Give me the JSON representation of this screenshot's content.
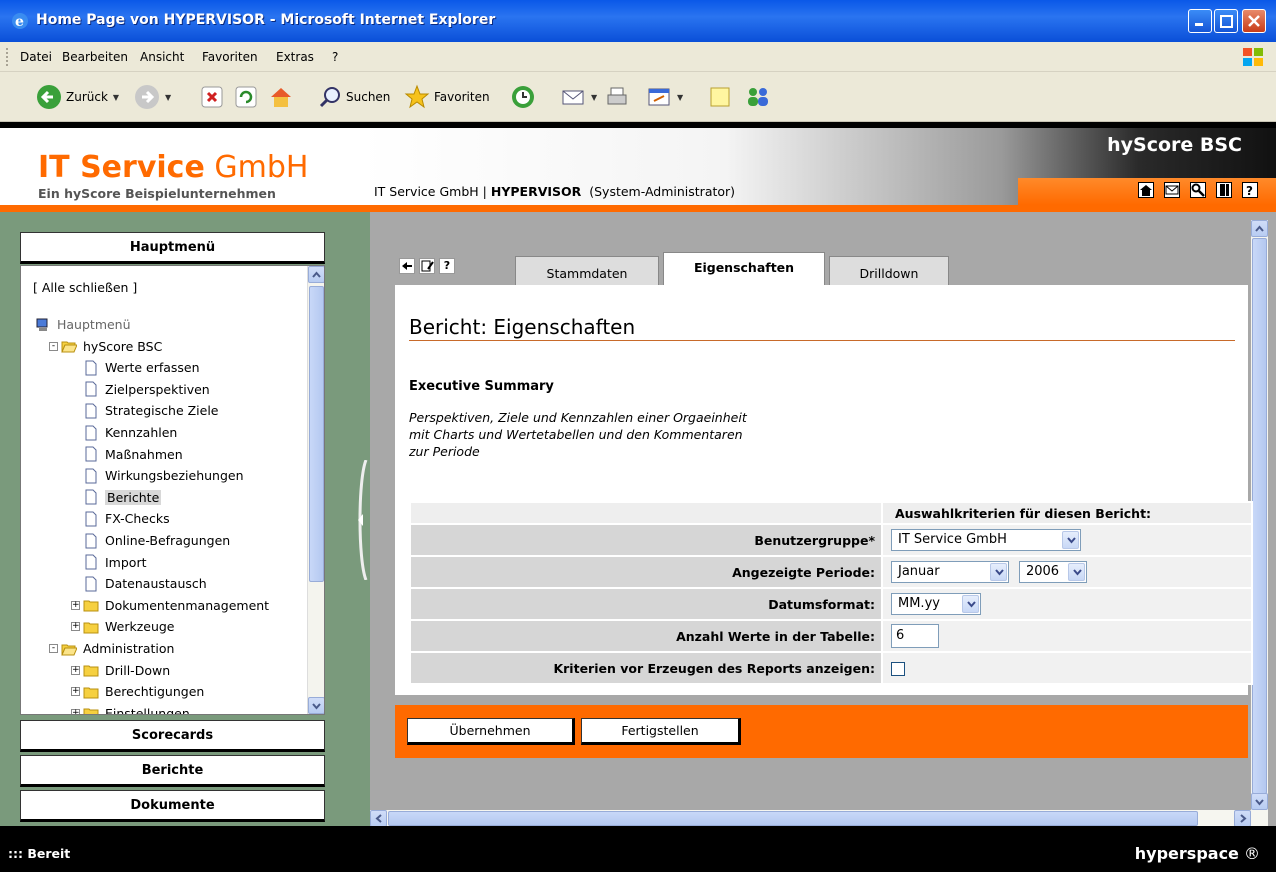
{
  "window": {
    "title": "Home Page von HYPERVISOR - Microsoft Internet Explorer"
  },
  "menubar": {
    "items": [
      "Datei",
      "Bearbeiten",
      "Ansicht",
      "Favoriten",
      "Extras",
      "?"
    ]
  },
  "toolbar": {
    "back_label": "Zurück",
    "search_label": "Suchen",
    "favorites_label": "Favoriten"
  },
  "header": {
    "company_bold": "IT Service",
    "company_rest": "GmbH",
    "tagline": "Ein hyScore Beispielunternehmen",
    "context_company": "IT Service GmbH",
    "context_sep": "|",
    "context_user": "HYPERVISOR",
    "context_role": "(System-Administrator)",
    "brand": "hyScore BSC"
  },
  "sidebar": {
    "main_menu": "Hauptmenü",
    "close_all": "[ Alle schließen ]",
    "tree": [
      {
        "label": "Hauptmenü",
        "level": 0,
        "icon": "computer-icon",
        "muted": true
      },
      {
        "label": "hyScore BSC",
        "level": 1,
        "icon": "folder-open-icon",
        "toggle": "-"
      },
      {
        "label": "Werte erfassen",
        "level": 2,
        "icon": "page-icon"
      },
      {
        "label": "Zielperspektiven",
        "level": 2,
        "icon": "page-icon"
      },
      {
        "label": "Strategische Ziele",
        "level": 2,
        "icon": "page-icon"
      },
      {
        "label": "Kennzahlen",
        "level": 2,
        "icon": "page-icon"
      },
      {
        "label": "Maßnahmen",
        "level": 2,
        "icon": "page-icon"
      },
      {
        "label": "Wirkungsbeziehungen",
        "level": 2,
        "icon": "page-icon"
      },
      {
        "label": "Berichte",
        "level": 2,
        "icon": "page-icon",
        "selected": true
      },
      {
        "label": "FX-Checks",
        "level": 2,
        "icon": "page-icon"
      },
      {
        "label": "Online-Befragungen",
        "level": 2,
        "icon": "page-icon"
      },
      {
        "label": "Import",
        "level": 2,
        "icon": "page-icon"
      },
      {
        "label": "Datenaustausch",
        "level": 2,
        "icon": "page-icon"
      },
      {
        "label": "Dokumentenmanagement",
        "level": 2,
        "icon": "folder-icon",
        "toggle": "+"
      },
      {
        "label": "Werkzeuge",
        "level": 2,
        "icon": "folder-icon",
        "toggle": "+"
      },
      {
        "label": "Administration",
        "level": 1,
        "icon": "folder-open-icon",
        "toggle": "-"
      },
      {
        "label": "Drill-Down",
        "level": 2,
        "icon": "folder-icon",
        "toggle": "+"
      },
      {
        "label": "Berechtigungen",
        "level": 2,
        "icon": "folder-icon",
        "toggle": "+"
      },
      {
        "label": "Einstellungen",
        "level": 2,
        "icon": "folder-icon",
        "toggle": "+"
      }
    ],
    "sections": [
      "Scorecards",
      "Berichte",
      "Dokumente"
    ]
  },
  "content": {
    "tabs": [
      {
        "label": "Stammdaten",
        "active": false
      },
      {
        "label": "Eigenschaften",
        "active": true
      },
      {
        "label": "Drilldown",
        "active": false
      }
    ],
    "help_label": "?",
    "title": "Bericht: Eigenschaften",
    "summary_heading": "Executive Summary",
    "summary_lines": [
      "Perspektiven, Ziele und Kennzahlen einer Orgaeinheit",
      "mit Charts und Wertetabellen und den Kommentaren",
      "zur Periode"
    ],
    "criteria_header": "Auswahlkriterien für diesen Bericht:",
    "fields": {
      "group_label": "Benutzergruppe*",
      "group_value": "IT Service GmbH",
      "period_label": "Angezeigte Periode:",
      "period_month": "Januar",
      "period_year": "2006",
      "format_label": "Datumsformat:",
      "format_value": "MM.yy",
      "count_label": "Anzahl Werte in der Tabelle:",
      "count_value": "6",
      "show_label": "Kriterien vor Erzeugen des Reports anzeigen:",
      "show_checked": false
    },
    "buttons": {
      "apply": "Übernehmen",
      "finish": "Fertigstellen"
    }
  },
  "statusbar": {
    "text": "::: Bereit",
    "logo": "hyperspace"
  },
  "colors": {
    "accent": "#ff6a00",
    "xp_blue": "#0a58e8",
    "sidebar_green": "#7a9a7c",
    "content_gray": "#a8a8a8"
  }
}
